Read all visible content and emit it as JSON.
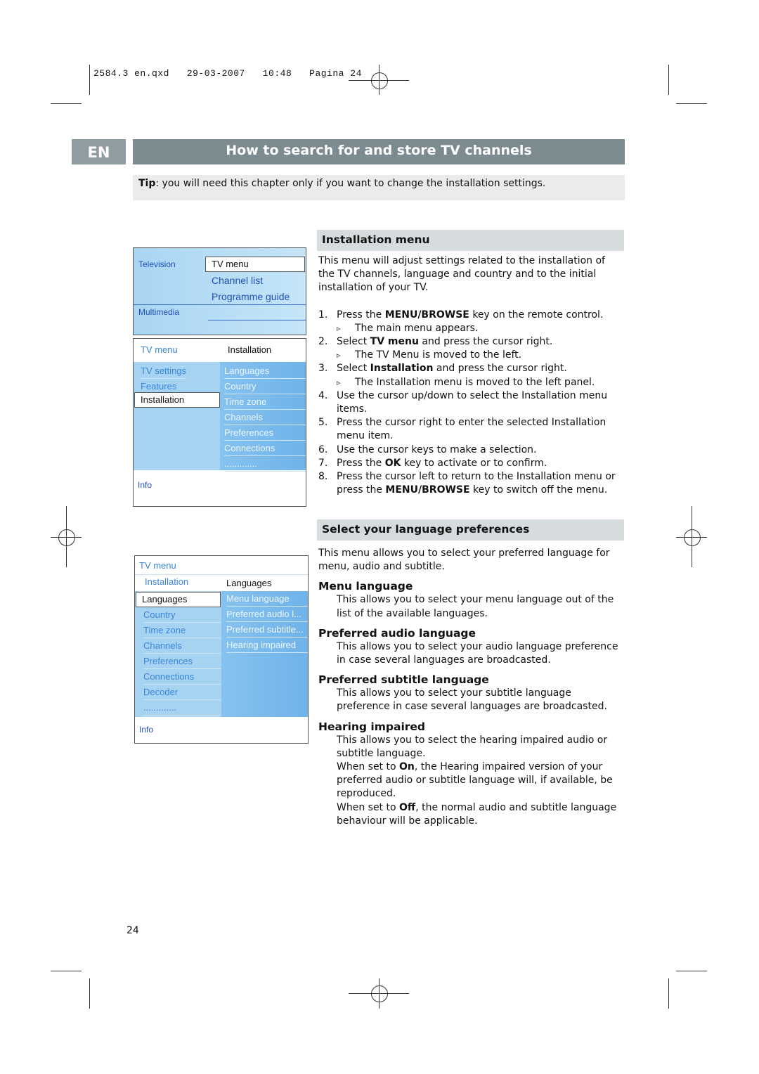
{
  "slug": {
    "file": "2584.3 en.qxd",
    "date": "29-03-2007",
    "time": "10:48",
    "page": "Pagina 24"
  },
  "lang_tab": "EN",
  "title": "How to search for and store TV channels",
  "tip": {
    "label": "Tip",
    "text": ": you will need this chapter only if you want to change the installation settings."
  },
  "menu1": {
    "top": {
      "left": [
        "Television",
        "Multimedia"
      ],
      "right": [
        "TV menu",
        "Channel list",
        "Programme guide"
      ]
    },
    "header": {
      "left": "TV menu",
      "right": "Installation"
    },
    "left": [
      "TV settings",
      "Features",
      "Installation"
    ],
    "right": [
      "Languages",
      "Country",
      "Time zone",
      "Channels",
      "Preferences",
      "Connections",
      "............."
    ],
    "info": "Info"
  },
  "menu2": {
    "title": "TV menu",
    "header": {
      "left": "Installation",
      "right": "Languages"
    },
    "left": [
      "Languages",
      "Country",
      "Time zone",
      "Channels",
      "Preferences",
      "Connections",
      "Decoder",
      "............."
    ],
    "right": [
      "Menu language",
      "Preferred audio l...",
      "Preferred subtitle...",
      "Hearing impaired"
    ],
    "info": "Info"
  },
  "install": {
    "heading": "Installation menu",
    "intro": "This menu will adjust settings related to the installation of the TV channels, language and country and to the initial installation of your TV.",
    "steps": [
      {
        "n": "1.",
        "pre": "Press the ",
        "b": "MENU/BROWSE",
        "post": " key on the remote control.",
        "result": "The main menu appears."
      },
      {
        "n": "2.",
        "pre": "Select ",
        "b": "TV menu",
        "post": " and press the cursor right.",
        "result": "The TV Menu is moved to the left."
      },
      {
        "n": "3.",
        "pre": "Select ",
        "b": "Installation",
        "post": " and press the cursor right.",
        "result": "The Installation menu is moved to the left panel."
      },
      {
        "n": "4.",
        "pre": "Use the cursor up/down to select the Installation menu items.",
        "b": "",
        "post": ""
      },
      {
        "n": "5.",
        "pre": "Press the cursor right to enter the selected Installation menu item.",
        "b": "",
        "post": ""
      },
      {
        "n": "6.",
        "pre": "Use the cursor keys to make a selection.",
        "b": "",
        "post": ""
      },
      {
        "n": "7.",
        "pre": "Press the ",
        "b": "OK",
        "post": " key to activate or to confirm."
      },
      {
        "n": "8.",
        "pre": "Press the cursor left to return to the Installation menu or press the ",
        "b": "MENU/BROWSE",
        "post": " key to switch off the menu."
      }
    ]
  },
  "language": {
    "heading": "Select your language preferences",
    "intro": "This menu allows you to select your preferred language for menu, audio and subtitle.",
    "menu_h": "Menu language",
    "menu_t": "This allows you to select your menu language out of the list of the available languages.",
    "audio_h": "Preferred audio language",
    "audio_t": "This allows you to select your audio language preference in case several languages are broadcasted.",
    "sub_h": "Preferred subtitle language",
    "sub_t": "This allows you to select your subtitle language preference in case several languages are broadcasted.",
    "hear_h": "Hearing impaired",
    "hear_t1": "This allows you to select the hearing impaired audio or subtitle language.",
    "hear_on_pre": "When set to ",
    "hear_on_b": "On",
    "hear_on_post": ", the Hearing impaired version of your preferred audio or subtitle language will, if available, be reproduced.",
    "hear_off_pre": "When set to ",
    "hear_off_b": "Off",
    "hear_off_post": ", the normal audio and subtitle language behaviour will be applicable."
  },
  "page_number": "24"
}
